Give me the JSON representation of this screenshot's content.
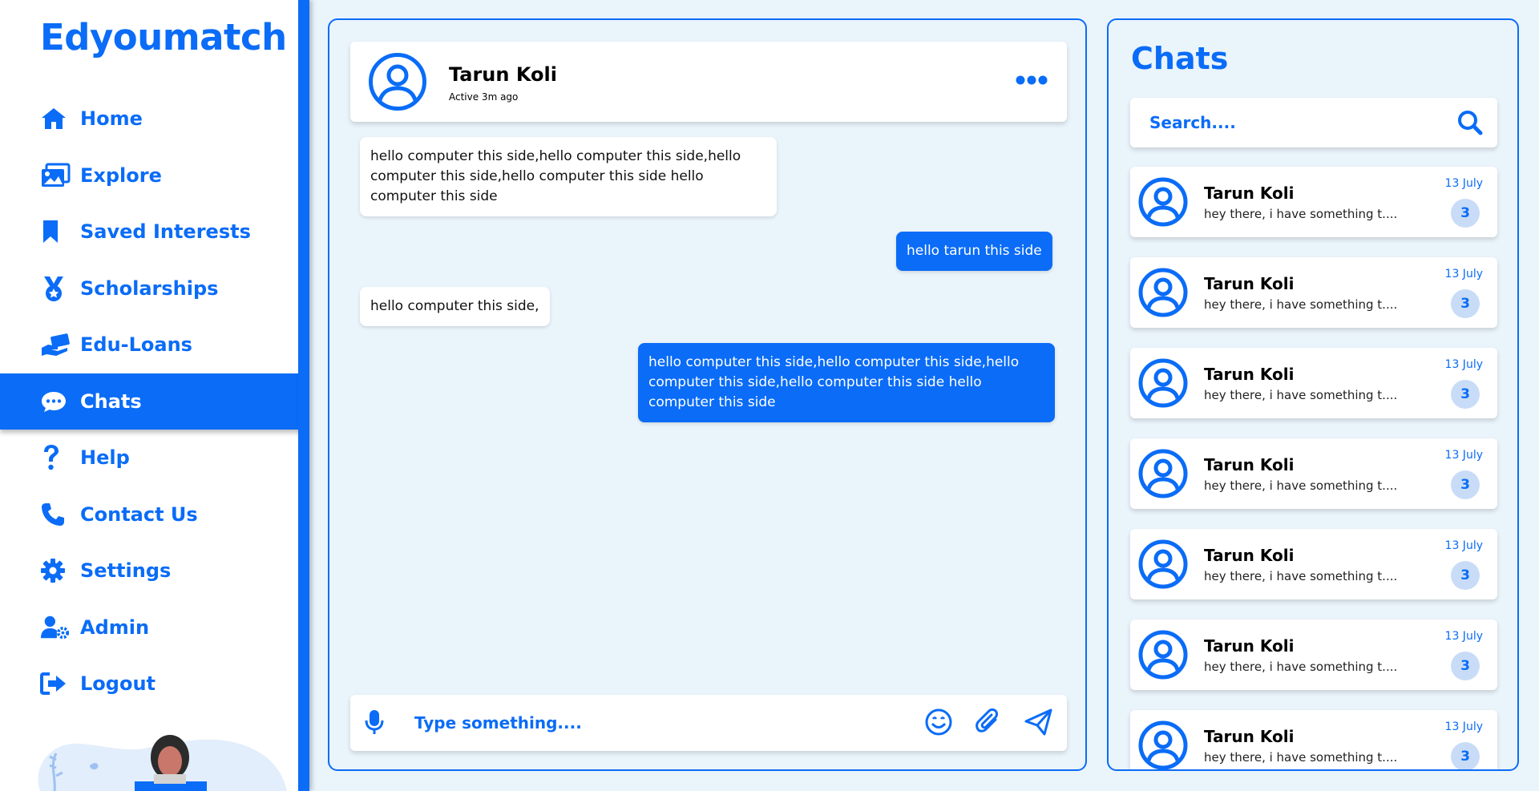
{
  "brand": "Edyoumatch",
  "nav": [
    {
      "label": "Home",
      "icon": "home-icon"
    },
    {
      "label": "Explore",
      "icon": "images-icon"
    },
    {
      "label": "Saved Interests",
      "icon": "bookmark-icon"
    },
    {
      "label": "Scholarships",
      "icon": "medal-icon"
    },
    {
      "label": "Edu-Loans",
      "icon": "hand-money-icon"
    },
    {
      "label": "Chats",
      "icon": "chat-bubbles-icon",
      "active": true
    },
    {
      "label": "Help",
      "icon": "question-icon"
    },
    {
      "label": "Contact Us",
      "icon": "phone-icon"
    },
    {
      "label": "Settings",
      "icon": "gear-icon"
    },
    {
      "label": "Admin",
      "icon": "user-gear-icon"
    },
    {
      "label": "Logout",
      "icon": "logout-icon"
    }
  ],
  "conversation": {
    "name": "Tarun Koli",
    "status": "Active 3m ago",
    "messages": [
      {
        "direction": "in",
        "text": "hello computer this side,hello computer this side,hello computer this side,hello computer this side hello computer this side"
      },
      {
        "direction": "out",
        "text": "hello tarun this side"
      },
      {
        "direction": "in",
        "text": "hello computer this side,"
      },
      {
        "direction": "out",
        "text": "hello computer this side,hello computer this side,hello computer this side,hello computer this side hello computer this side"
      }
    ],
    "composer_placeholder": "Type something...."
  },
  "chats": {
    "title": "Chats",
    "search_placeholder": "Search....",
    "items": [
      {
        "name": "Tarun Koli",
        "preview": "hey there, i have something t....",
        "date": "13 July",
        "unread": "3"
      },
      {
        "name": "Tarun Koli",
        "preview": "hey there, i have something t....",
        "date": "13 July",
        "unread": "3"
      },
      {
        "name": "Tarun Koli",
        "preview": "hey there, i have something t....",
        "date": "13 July",
        "unread": "3"
      },
      {
        "name": "Tarun Koli",
        "preview": "hey there, i have something t....",
        "date": "13 July",
        "unread": "3"
      },
      {
        "name": "Tarun Koli",
        "preview": "hey there, i have something t....",
        "date": "13 July",
        "unread": "3"
      },
      {
        "name": "Tarun Koli",
        "preview": "hey there, i have something t....",
        "date": "13 July",
        "unread": "3"
      },
      {
        "name": "Tarun Koli",
        "preview": "hey there, i have something t....",
        "date": "13 July",
        "unread": "3"
      }
    ]
  },
  "colors": {
    "accent": "#0a6cf7",
    "background": "#eaf4fb",
    "badge": "#c8dcf7"
  }
}
